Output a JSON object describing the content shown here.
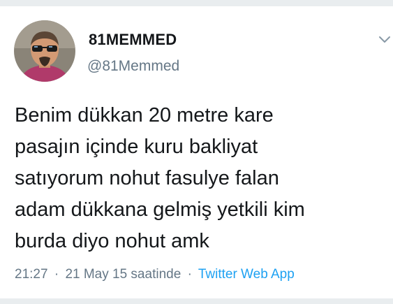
{
  "user": {
    "display_name": "81MEMMED",
    "handle": "@81Memmed",
    "avatar_icon": "profile-photo"
  },
  "tweet": {
    "text_lines": [
      "Benim dükkan 20 metre kare",
      "pasajın içinde kuru bakliyat",
      "satıyorum nohut fasulye falan",
      "adam dükkana gelmiş yetkili kim",
      "burda diyo nohut amk"
    ],
    "time": "21:27",
    "date": "21 May 15 saatinde",
    "separator": "·",
    "source": "Twitter Web App"
  },
  "menu": {
    "icon": "chevron-down-icon"
  },
  "colors": {
    "text": "#14171a",
    "secondary": "#657786",
    "link": "#1da1f2",
    "divider": "#e9edef"
  }
}
